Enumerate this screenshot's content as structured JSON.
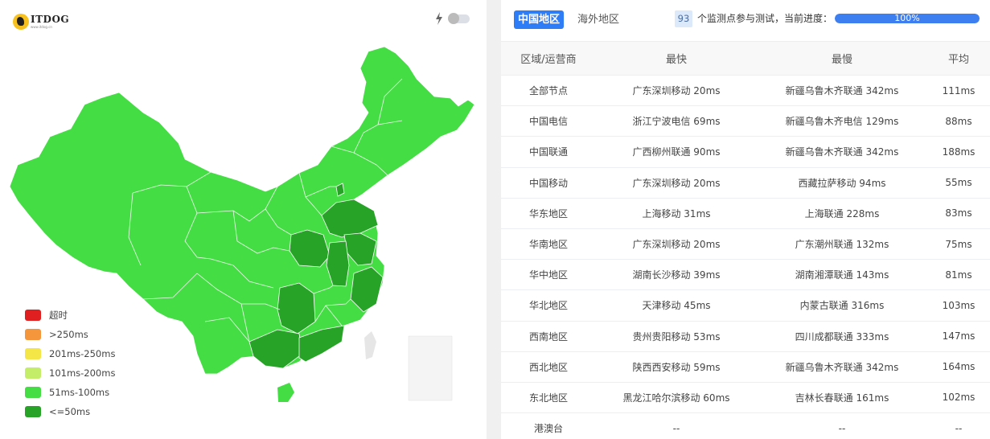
{
  "logo": {
    "name": "ITDOG",
    "url": "www.itdog.cn"
  },
  "legend": [
    {
      "label": "超时",
      "color": "#e02020"
    },
    {
      "label": ">250ms",
      "color": "#f6963c"
    },
    {
      "label": "201ms-250ms",
      "color": "#f5e648"
    },
    {
      "label": "101ms-200ms",
      "color": "#c4ee6a"
    },
    {
      "label": "51ms-100ms",
      "color": "#44dd44"
    },
    {
      "label": "<=50ms",
      "color": "#27a327"
    }
  ],
  "tabs": {
    "china": "中国地区",
    "overseas": "海外地区"
  },
  "status": {
    "node_count": "93",
    "text": "个监测点参与测试，当前进度：",
    "progress_label": "100%",
    "progress_fraction": 1.0
  },
  "table": {
    "headers": [
      "区域/运营商",
      "最快",
      "最慢",
      "平均"
    ],
    "rows": [
      [
        "全部节点",
        "广东深圳移动 20ms",
        "新疆乌鲁木齐联通 342ms",
        "111ms"
      ],
      [
        "中国电信",
        "浙江宁波电信 69ms",
        "新疆乌鲁木齐电信 129ms",
        "88ms"
      ],
      [
        "中国联通",
        "广西柳州联通 90ms",
        "新疆乌鲁木齐联通 342ms",
        "188ms"
      ],
      [
        "中国移动",
        "广东深圳移动 20ms",
        "西藏拉萨移动 94ms",
        "55ms"
      ],
      [
        "华东地区",
        "上海移动 31ms",
        "上海联通 228ms",
        "83ms"
      ],
      [
        "华南地区",
        "广东深圳移动 20ms",
        "广东潮州联通 132ms",
        "75ms"
      ],
      [
        "华中地区",
        "湖南长沙移动 39ms",
        "湖南湘潭联通 143ms",
        "81ms"
      ],
      [
        "华北地区",
        "天津移动 45ms",
        "内蒙古联通 316ms",
        "103ms"
      ],
      [
        "西南地区",
        "贵州贵阳移动 53ms",
        "四川成都联通 333ms",
        "147ms"
      ],
      [
        "西北地区",
        "陕西西安移动 59ms",
        "新疆乌鲁木齐联通 342ms",
        "164ms"
      ],
      [
        "东北地区",
        "黑龙江哈尔滨移动 60ms",
        "吉林长春联通 161ms",
        "102ms"
      ],
      [
        "港澳台",
        "--",
        "--",
        "--"
      ]
    ]
  },
  "colors": {
    "map_default": "#44dd44",
    "map_fast": "#27a327",
    "accent": "#2f7df6"
  }
}
